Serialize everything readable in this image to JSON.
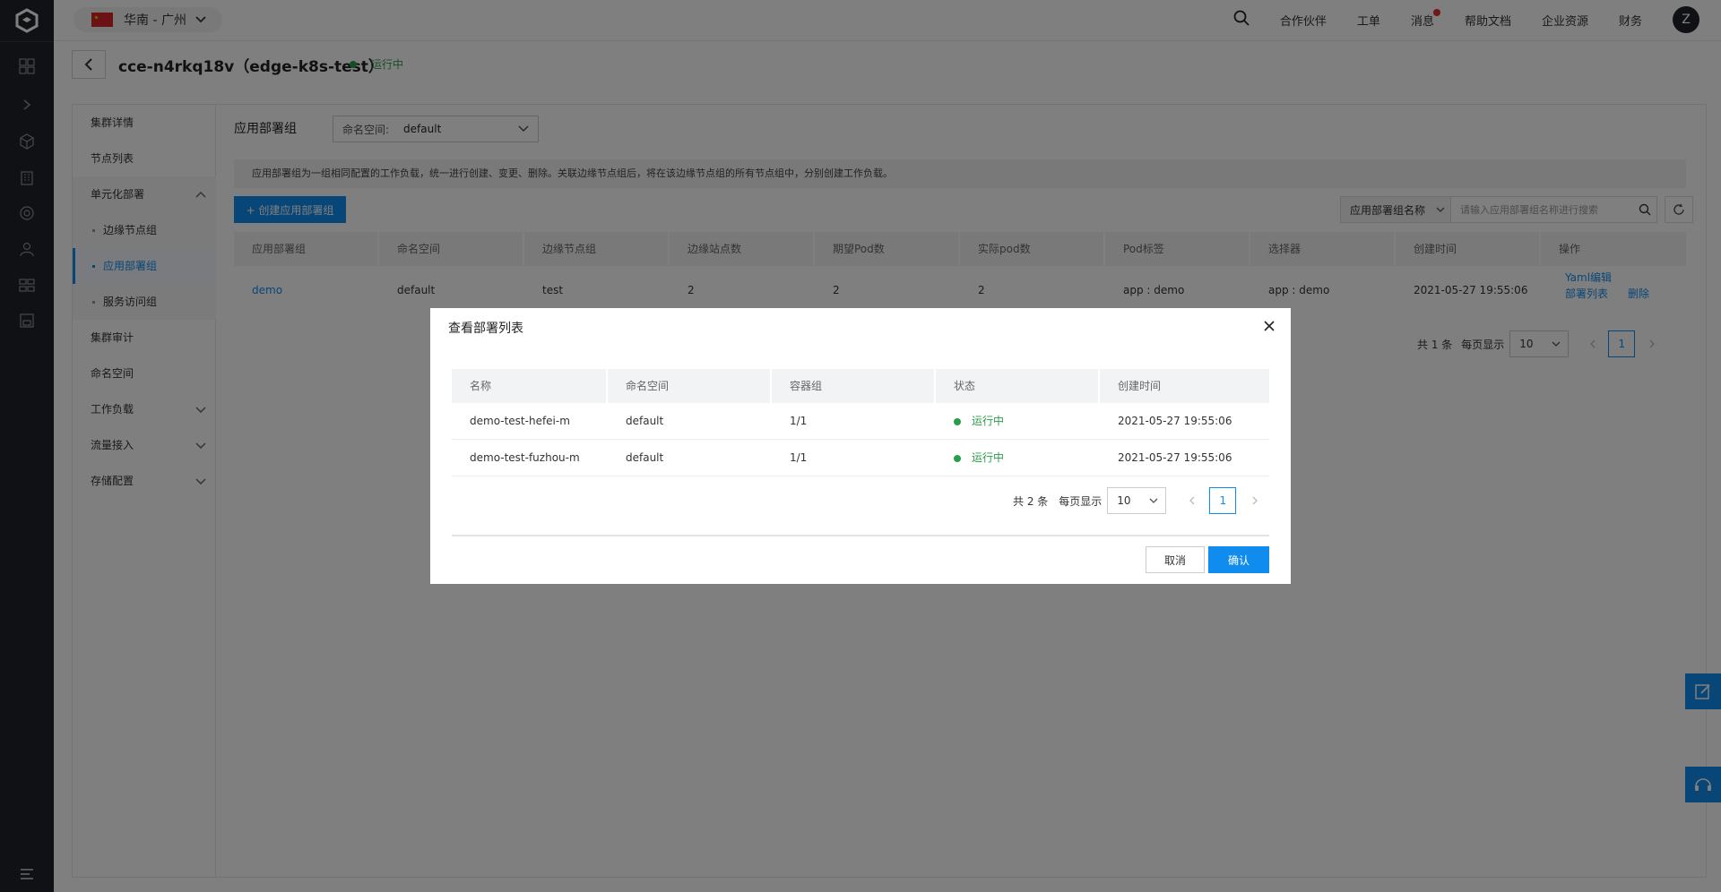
{
  "topbar": {
    "region": "华南 - 广州",
    "nav": [
      "合作伙伴",
      "工单",
      "消息",
      "帮助文档",
      "企业资源",
      "财务"
    ],
    "avatar_initial": "Z"
  },
  "cluster": {
    "title": "cce-n4rkq18v（edge-k8s-test）",
    "status": "运行中"
  },
  "sidebar": {
    "items": [
      {
        "label": "集群详情"
      },
      {
        "label": "节点列表"
      },
      {
        "label": "单元化部署"
      },
      {
        "label": "边缘节点组"
      },
      {
        "label": "应用部署组"
      },
      {
        "label": "服务访问组"
      },
      {
        "label": "集群审计"
      },
      {
        "label": "命名空间"
      },
      {
        "label": "工作负载"
      },
      {
        "label": "流量接入"
      },
      {
        "label": "存储配置"
      }
    ]
  },
  "content": {
    "title": "应用部署组",
    "namespace_label": "命名空间:",
    "namespace_value": "default",
    "notice": "应用部署组为一组相同配置的工作负载，统一进行创建、变更、删除。关联边缘节点组后，将在该边缘节点组的所有节点组中，分别创建工作负载。",
    "create_button": "+ 创建应用部署组",
    "search_type": "应用部署组名称",
    "search_placeholder": "请输入应用部署组名称进行搜索",
    "columns": [
      "应用部署组",
      "命名空间",
      "边缘节点组",
      "边缘站点数",
      "期望Pod数",
      "实际pod数",
      "Pod标签",
      "选择器",
      "创建时间",
      "操作"
    ],
    "rows": [
      {
        "name": "demo",
        "namespace": "default",
        "node_group": "test",
        "sites": "2",
        "desired": "2",
        "actual": "2",
        "labels": "app : demo",
        "selector": "app : demo",
        "created": "2021-05-27 19:55:06",
        "op_yaml": "Yaml编辑",
        "op_list": "部署列表",
        "op_delete": "删除"
      }
    ],
    "pager": {
      "total": "共 1 条",
      "per_page_label": "每页显示",
      "per_page": "10",
      "page": "1"
    }
  },
  "modal": {
    "title": "查看部署列表",
    "columns": [
      "名称",
      "命名空间",
      "容器组",
      "状态",
      "创建时间"
    ],
    "rows": [
      {
        "name": "demo-test-hefei-m",
        "namespace": "default",
        "pods": "1/1",
        "status": "运行中",
        "created": "2021-05-27 19:55:06"
      },
      {
        "name": "demo-test-fuzhou-m",
        "namespace": "default",
        "pods": "1/1",
        "status": "运行中",
        "created": "2021-05-27 19:55:06"
      }
    ],
    "pager": {
      "total": "共 2 条",
      "per_page_label": "每页显示",
      "per_page": "10",
      "page": "1"
    },
    "cancel": "取消",
    "confirm": "确认"
  },
  "colors": {
    "accent": "#108cee",
    "running": "#2a9d4a",
    "rail": "#1f2329"
  }
}
